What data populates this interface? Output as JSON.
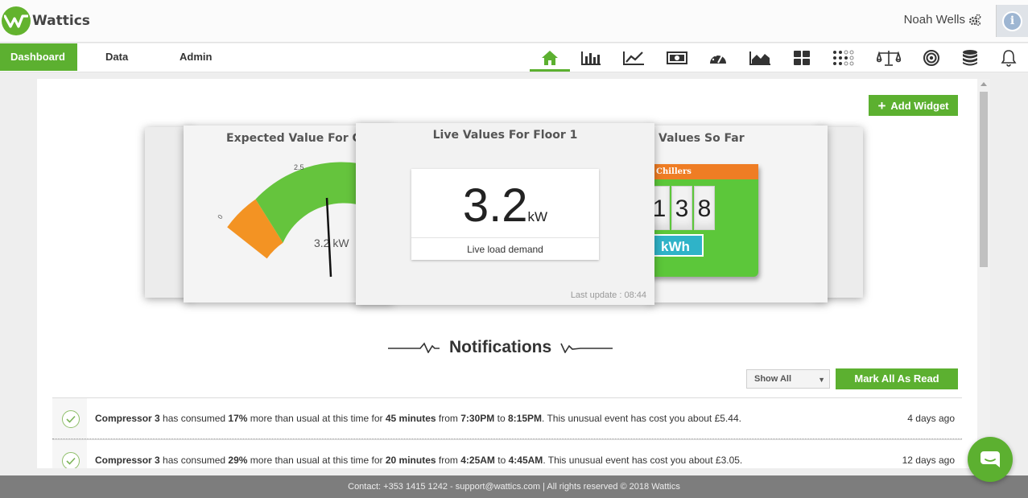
{
  "app": {
    "name": "Wattics"
  },
  "header": {
    "user_name": "Noah Wells",
    "info_icon": "info-icon",
    "info_glyph": "i"
  },
  "nav": {
    "tabs": [
      {
        "label": "Dashboard",
        "active": true
      },
      {
        "label": "Data",
        "active": false
      },
      {
        "label": "Admin",
        "active": false
      }
    ],
    "icons": [
      "home-icon",
      "bar-chart-icon",
      "line-chart-icon",
      "money-icon",
      "gauge-icon",
      "area-chart-icon",
      "widgets-icon",
      "heatmap-icon",
      "balance-icon",
      "target-icon",
      "database-icon",
      "bell-icon"
    ]
  },
  "toolbar": {
    "add_widget_label": "Add Widget"
  },
  "widgets": {
    "expected": {
      "title": "Expected Value For Co",
      "tick_label": "2.5",
      "zero_label": "0",
      "value_label": "3.2 kW"
    },
    "live": {
      "title": "Live Values For Floor 1",
      "value": "3.2",
      "unit": "kW",
      "label": "Live load demand",
      "last_update": "Last update : 08:44"
    },
    "sofar": {
      "title": "Values So Far",
      "meter_title": "Chillers",
      "digits": [
        "1",
        "3",
        "8"
      ],
      "unit": "kWh"
    }
  },
  "notifications": {
    "title": "Notifications",
    "filter_value": "Show All",
    "mark_read_label": "Mark All As Read",
    "items": [
      {
        "device": "Compressor 3",
        "t1": " has consumed ",
        "pct": "17%",
        "t2": " more than usual at this time for ",
        "dur": "45 minutes",
        "t3": " from ",
        "from": "7:30PM",
        "t4": " to ",
        "to": "8:15PM",
        "t5": ". This unusual event has cost you about £5.44.",
        "time": "4 days ago"
      },
      {
        "device": "Compressor 3",
        "t1": " has consumed ",
        "pct": "29%",
        "t2": " more than usual at this time for ",
        "dur": "20 minutes",
        "t3": " from ",
        "from": "4:25AM",
        "t4": " to ",
        "to": "4:45AM",
        "t5": ". This unusual event has cost you about £3.05.",
        "time": "12 days ago"
      }
    ]
  },
  "footer": {
    "text": "Contact: +353 1415 1242 - support@wattics.com | All rights reserved © 2018 Wattics"
  },
  "colors": {
    "brand_green": "#5cb030",
    "meter_orange": "#ef7d24",
    "kwh_teal": "#2fb3c8"
  }
}
